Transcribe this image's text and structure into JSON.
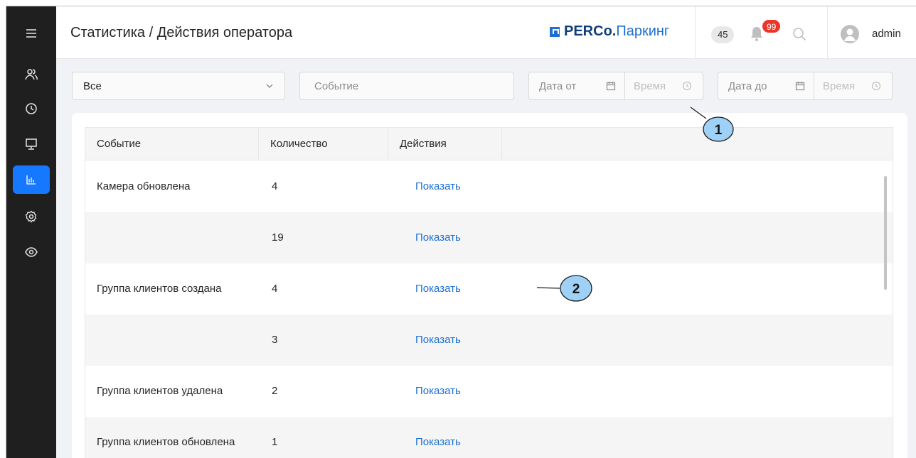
{
  "sidebar": {
    "items": [
      {
        "icon": "menu-icon",
        "active": false
      },
      {
        "icon": "users-icon",
        "active": false
      },
      {
        "icon": "history-icon",
        "active": false
      },
      {
        "icon": "monitor-icon",
        "active": false
      },
      {
        "icon": "statistics-icon",
        "active": true
      },
      {
        "icon": "settings-icon",
        "active": false
      },
      {
        "icon": "eye-icon",
        "active": false
      }
    ]
  },
  "header": {
    "title": "Статистика / Действия оператора",
    "logo_brand": "PERCo.",
    "logo_product": "Паркинг",
    "counter": "45",
    "notifications": "99",
    "username": "admin"
  },
  "filters": {
    "type_value": "Все",
    "event_placeholder": "Событие",
    "date_from_placeholder": "Дата от",
    "time_from_placeholder": "Время",
    "date_to_placeholder": "Дата до",
    "time_to_placeholder": "Время"
  },
  "table": {
    "columns": [
      "Событие",
      "Количество",
      "Действия"
    ],
    "rows": [
      {
        "event": "Камера обновлена",
        "count": "4",
        "action": "Показать"
      },
      {
        "event": "",
        "count": "19",
        "action": "Показать"
      },
      {
        "event": "Группа клиентов создана",
        "count": "4",
        "action": "Показать"
      },
      {
        "event": "",
        "count": "3",
        "action": "Показать"
      },
      {
        "event": "Группа клиентов удалена",
        "count": "2",
        "action": "Показать"
      },
      {
        "event": "Группа клиентов обновлена",
        "count": "1",
        "action": "Показать"
      }
    ]
  },
  "callouts": {
    "one": "1",
    "two": "2"
  },
  "colors": {
    "sidebar_bg": "#1f1f1f",
    "accent": "#1677ff",
    "link": "#1d6fd1",
    "badge": "#e8362b",
    "callout_fill": "#9fd0f5"
  }
}
